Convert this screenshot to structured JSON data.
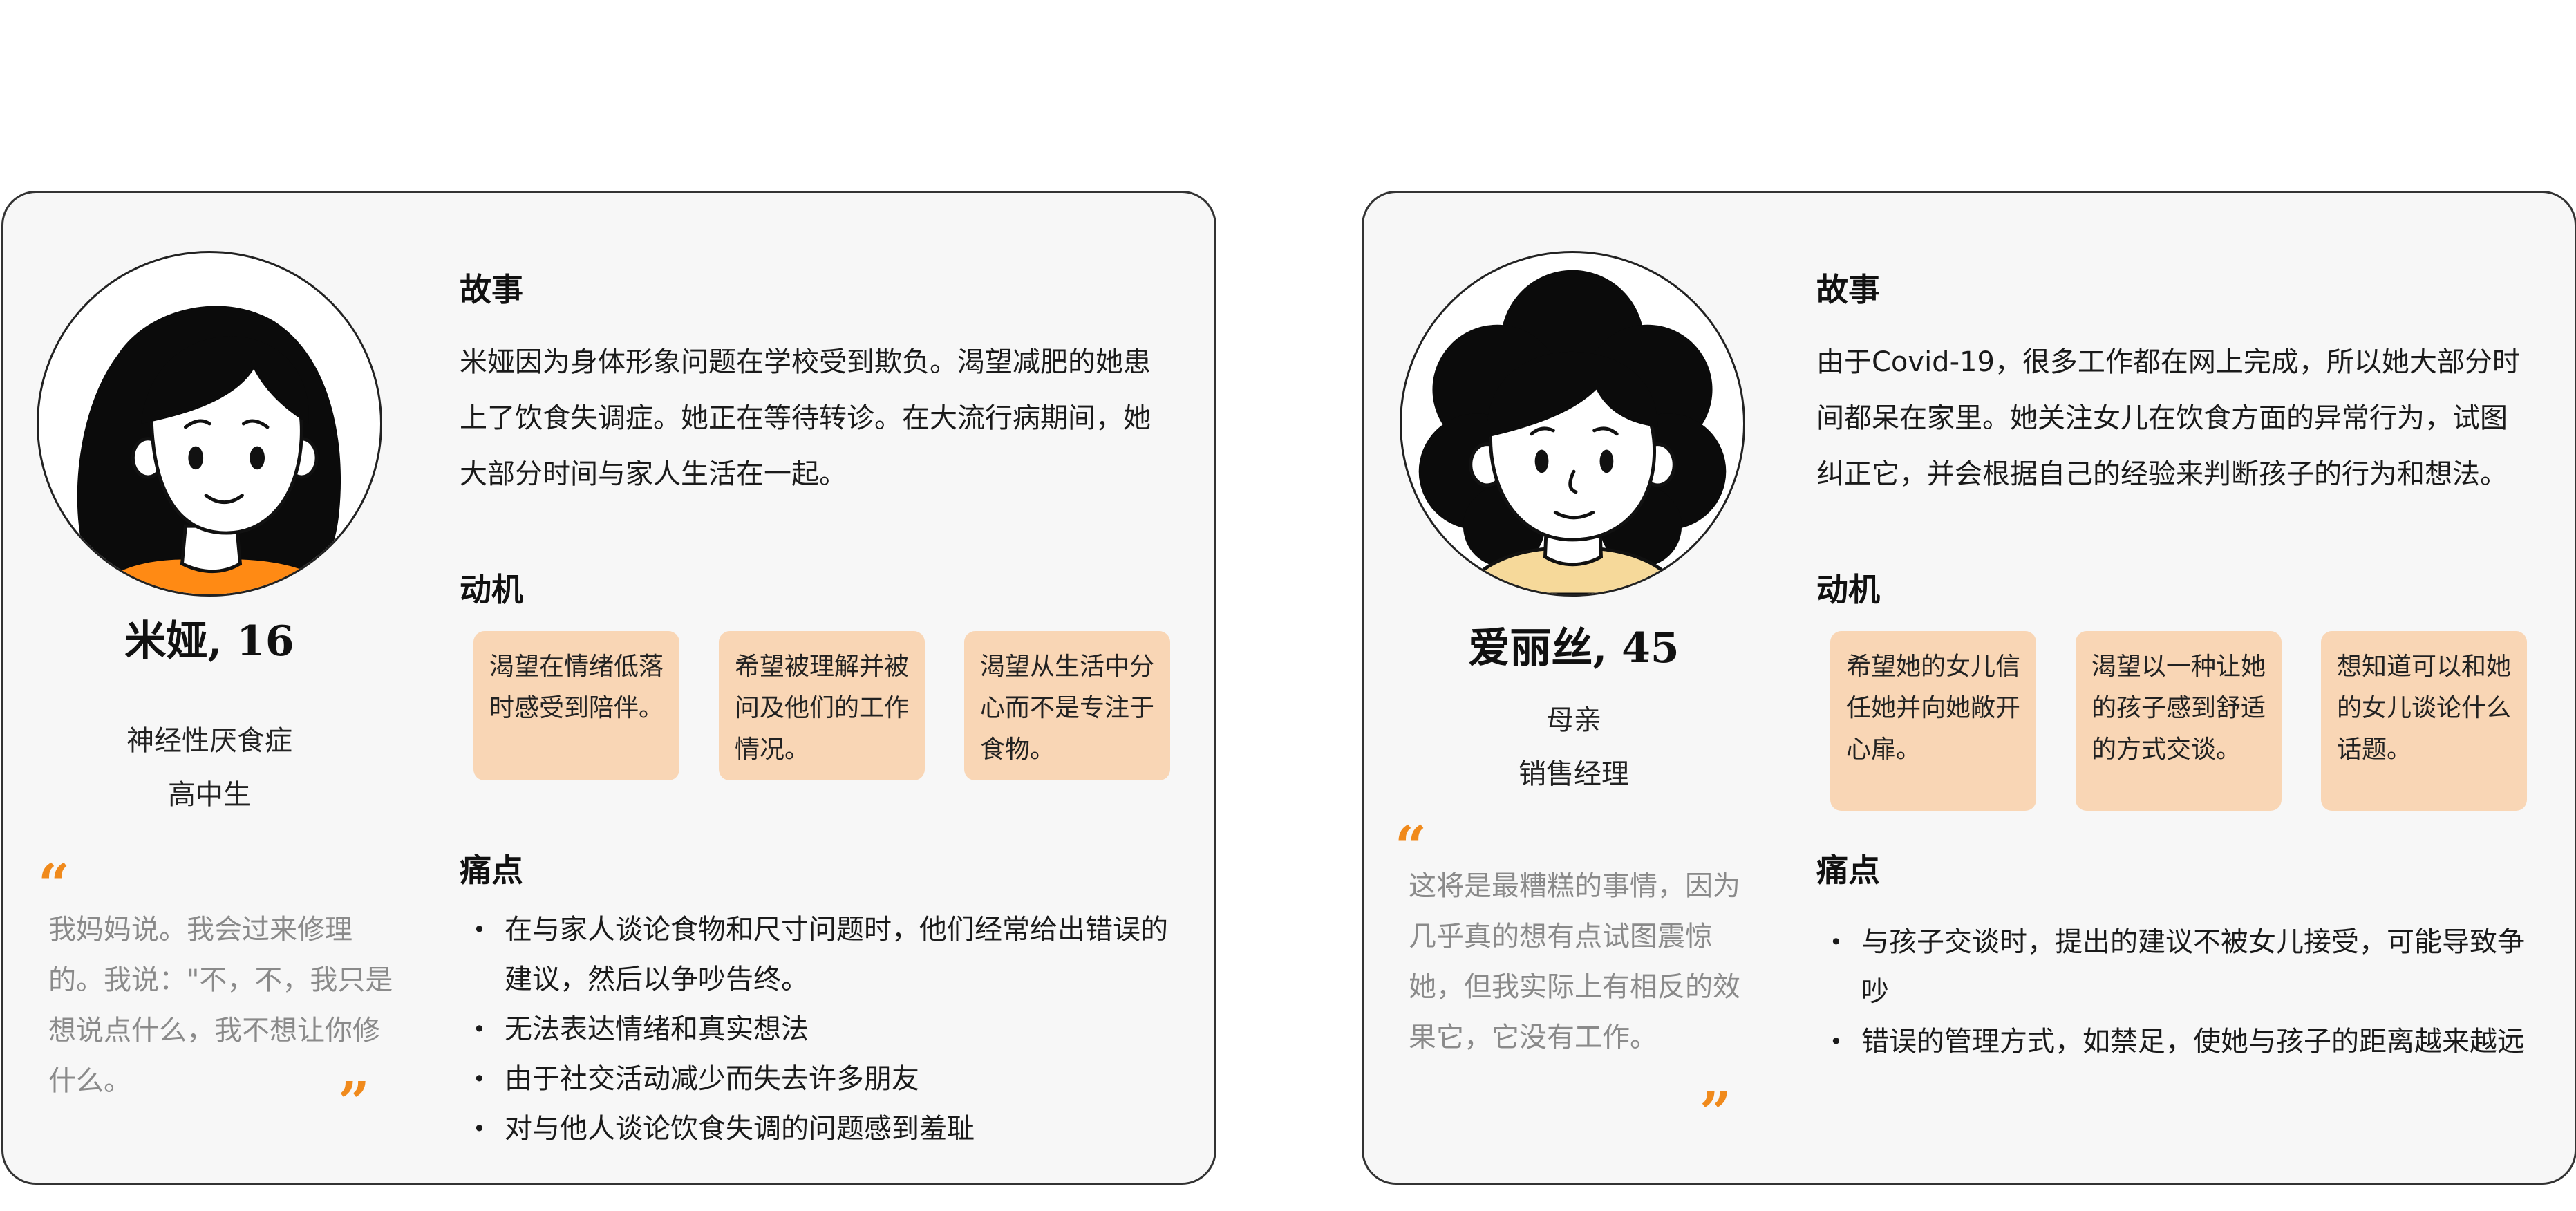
{
  "personas": [
    {
      "name": "米娅, 16",
      "details": [
        "神经性厌食症",
        "高中生"
      ],
      "quote": "我妈妈说。我会过来修理的。我说：\"不，不，我只是想说点什么，我不想让你修什么。",
      "story_title": "故事",
      "story": "米娅因为身体形象问题在学校受到欺负。渴望减肥的她患上了饮食失调症。她正在等待转诊。在大流行病期间，她大部分时间与家人生活在一起。",
      "motivation_title": "动机",
      "motivations": [
        "渴望在情绪低落时感受到陪伴。",
        "希望被理解并被问及他们的工作情况。",
        "渴望从生活中分心而不是专注于食物。"
      ],
      "pain_title": "痛点",
      "pain_points": [
        "在与家人谈论食物和尺寸问题时，他们经常给出错误的建议，然后以争吵告终。",
        "无法表达情绪和真实想法",
        "由于社交活动减少而失去许多朋友",
        "对与他人谈论饮食失调的问题感到羞耻"
      ]
    },
    {
      "name": "爱丽丝, 45",
      "details": [
        "母亲",
        "销售经理"
      ],
      "quote": "这将是最糟糕的事情，因为几乎真的想有点试图震惊她，但我实际上有相反的效果它，它没有工作。",
      "story_title": "故事",
      "story": "由于Covid-19，很多工作都在网上完成，所以她大部分时间都呆在家里。她关注女儿在饮食方面的异常行为，试图纠正它，并会根据自己的经验来判断孩子的行为和想法。",
      "motivation_title": "动机",
      "motivations": [
        "希望她的女儿信任她并向她敞开心扉。",
        "渴望以一种让她的孩子感到舒适的方式交谈。",
        "想知道可以和她的女儿谈论什么话题。"
      ],
      "pain_title": "痛点",
      "pain_points": [
        "与孩子交谈时，提出的建议不被女儿接受，可能导致争吵",
        "错误的管理方式，如禁足，使她与孩子的距离越来越远"
      ]
    }
  ],
  "colors": {
    "accent_orange": "#f08a1c",
    "motivation_bg": "#f9d6b5",
    "card_bg": "#f7f7f7",
    "quote_text": "#8a8a8a"
  },
  "icons": {
    "avatar_1": "girl-avatar-illustration",
    "avatar_2": "mother-avatar-illustration",
    "quote_open": "quote-open-icon",
    "quote_close": "quote-close-icon"
  }
}
